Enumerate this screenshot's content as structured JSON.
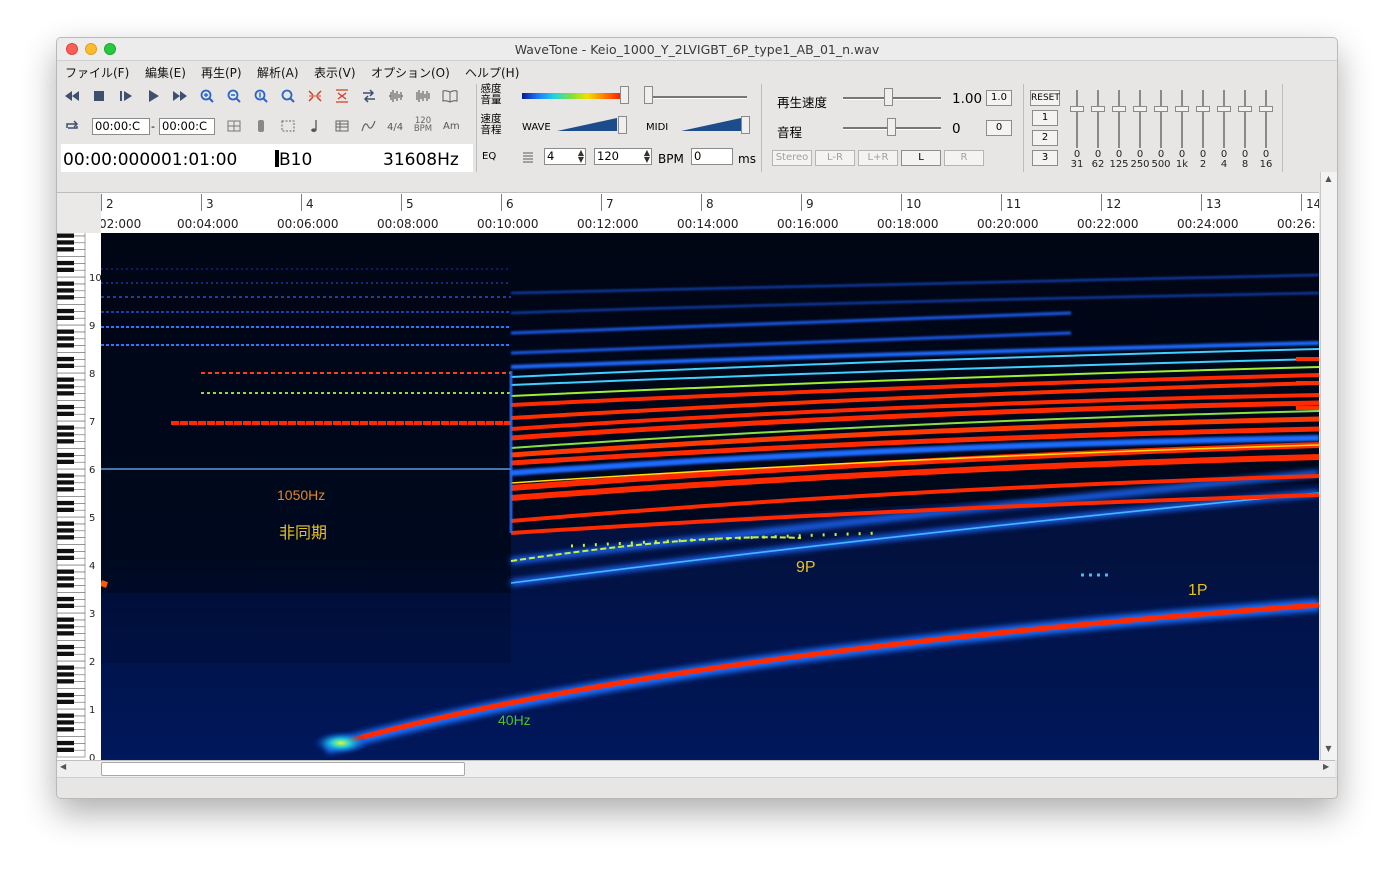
{
  "window": {
    "title": "WaveTone - Keio_1000_Y_2LVIGBT_6P_type1_AB_01_n.wav"
  },
  "menu": [
    "ファイル(F)",
    "編集(E)",
    "再生(P)",
    "解析(A)",
    "表示(V)",
    "オプション(O)",
    "ヘルプ(H)"
  ],
  "toolbar": {
    "time_signature": "4/4",
    "bpm_icon_top": "120",
    "bpm_icon_bottom": "BPM",
    "chord_label": "Am",
    "range_start": "00:00:C",
    "range_sep": "-",
    "range_end": "00:00:C",
    "position_time": "00:00:000001:01:00",
    "note_name": "B10",
    "frequency": "31608Hz",
    "sensitivity_label_1": "感度",
    "sensitivity_label_2": "音量",
    "speed_label_1": "速度",
    "speed_label_2": "音程",
    "eq_label": "EQ",
    "wave_label": "WAVE",
    "midi_label": "MIDI",
    "beats_value": "4",
    "tempo_value": "120",
    "bpm_unit": "BPM",
    "ms_value": "0",
    "ms_unit": "ms"
  },
  "playback": {
    "speed_label": "再生速度",
    "speed_value": "1.00",
    "speed_reset": "1.0",
    "pitch_label": "音程",
    "pitch_value": "0",
    "pitch_reset": "0",
    "channels": [
      "Stereo",
      "L-R",
      "L+R",
      "L",
      "R"
    ],
    "channel_enabled": [
      false,
      false,
      false,
      true,
      false
    ]
  },
  "equalizer": {
    "reset": "RESET",
    "presets": [
      "1",
      "2",
      "3"
    ],
    "bands": [
      {
        "top": "0",
        "bottom": "31"
      },
      {
        "top": "0",
        "bottom": "62"
      },
      {
        "top": "0",
        "bottom": "125"
      },
      {
        "top": "0",
        "bottom": "250"
      },
      {
        "top": "0",
        "bottom": "500"
      },
      {
        "top": "0",
        "bottom": "1k"
      },
      {
        "top": "0",
        "bottom": "2"
      },
      {
        "top": "0",
        "bottom": "4"
      },
      {
        "top": "0",
        "bottom": "8"
      },
      {
        "top": "0",
        "bottom": "16"
      }
    ]
  },
  "ruler": {
    "bars": [
      "2",
      "3",
      "4",
      "5",
      "6",
      "7",
      "8",
      "9",
      "10",
      "11",
      "12",
      "13",
      "14"
    ],
    "times": [
      "02:000",
      "00:04:000",
      "00:06:000",
      "00:08:000",
      "00:10:000",
      "00:12:000",
      "00:14:000",
      "00:16:000",
      "00:18:000",
      "00:20:000",
      "00:22:000",
      "00:24:000",
      "00:26:"
    ]
  },
  "piano_octaves": [
    "10",
    "9",
    "8",
    "7",
    "6",
    "5",
    "4",
    "3",
    "2",
    "1",
    "0"
  ],
  "annotations": {
    "async_freq": "1050Hz",
    "async_label": "非同期",
    "pulse_9p": "9P",
    "pulse_1p": "1P",
    "start_freq": "40Hz"
  },
  "colors": {
    "annotation_orange": "#e0852c",
    "annotation_yellow": "#e8c21a",
    "annotation_green": "#4fbf2c",
    "spectrogram_bg": "#000510",
    "spectrogram_peak": "#ff2a00"
  }
}
